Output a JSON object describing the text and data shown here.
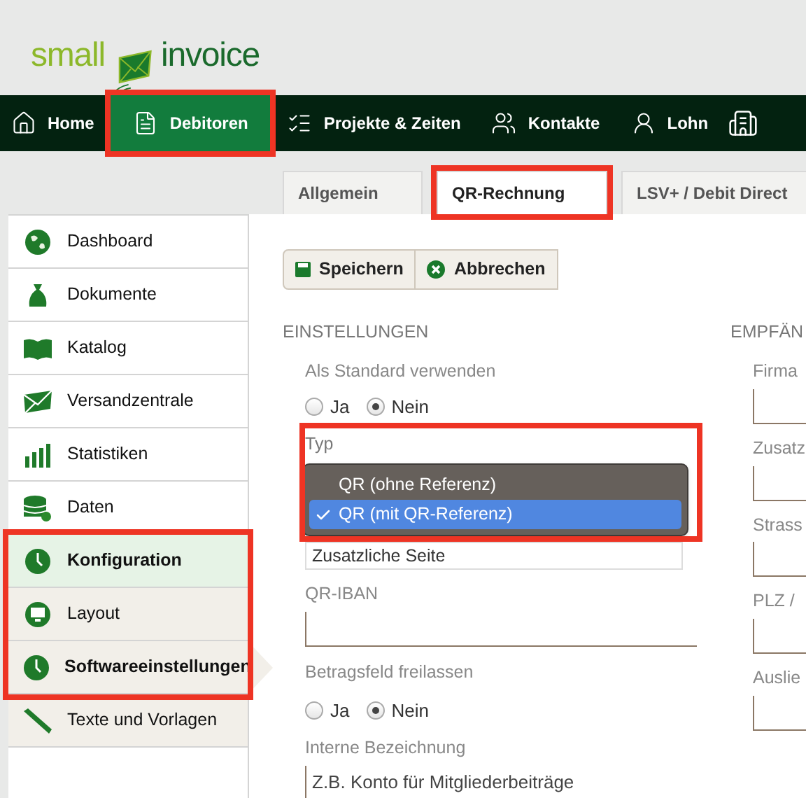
{
  "logo": {
    "text_left": "small",
    "text_right": "invoice"
  },
  "nav": [
    {
      "label": "Home",
      "selected": false,
      "highlighted": false
    },
    {
      "label": "Debitoren",
      "selected": true,
      "highlighted": true
    },
    {
      "label": "Projekte & Zeiten",
      "selected": false,
      "highlighted": false
    },
    {
      "label": "Kontakte",
      "selected": false,
      "highlighted": false
    },
    {
      "label": "Lohn",
      "selected": false,
      "highlighted": false
    }
  ],
  "tabs": [
    {
      "label": "Allgemein",
      "selected": false,
      "highlighted": false
    },
    {
      "label": "QR-Rechnung",
      "selected": true,
      "highlighted": true
    },
    {
      "label": "LSV+ / Debit Direct",
      "selected": false,
      "highlighted": false
    }
  ],
  "sidebar": {
    "items": [
      {
        "label": "Dashboard",
        "kind": "main",
        "selected": false,
        "highlighted": false
      },
      {
        "label": "Dokumente",
        "kind": "main",
        "selected": false,
        "highlighted": false
      },
      {
        "label": "Katalog",
        "kind": "main",
        "selected": false,
        "highlighted": false
      },
      {
        "label": "Versandzentrale",
        "kind": "main",
        "selected": false,
        "highlighted": false
      },
      {
        "label": "Statistiken",
        "kind": "main",
        "selected": false,
        "highlighted": false
      },
      {
        "label": "Daten",
        "kind": "main",
        "selected": false,
        "highlighted": false
      },
      {
        "label": "Konfiguration",
        "kind": "group",
        "selected": false,
        "highlighted": true
      },
      {
        "label": "Layout",
        "kind": "sub",
        "selected": false,
        "highlighted": true
      },
      {
        "label": "Softwareeinstellungen",
        "kind": "sub",
        "selected": true,
        "highlighted": true
      },
      {
        "label": "Texte und Vorlagen",
        "kind": "sub",
        "selected": false,
        "highlighted": false
      }
    ]
  },
  "toolbar": [
    {
      "label": "Speichern",
      "kind": "save"
    },
    {
      "label": "Abbrechen",
      "kind": "cancel"
    }
  ],
  "settings": {
    "heading": "EINSTELLUNGEN",
    "default": {
      "label": "Als Standard verwenden",
      "options": [
        {
          "label": "Ja",
          "selected": false
        },
        {
          "label": "Nein",
          "selected": true
        }
      ]
    },
    "type": {
      "label": "Typ",
      "highlighted": true,
      "options": [
        {
          "label": "QR (ohne Referenz)",
          "selected": false
        },
        {
          "label": "QR (mit QR-Referenz)",
          "selected": true
        }
      ]
    },
    "extra_page": {
      "value": "Zusatzliche Seite"
    },
    "qr_iban": {
      "label": "QR-IBAN"
    },
    "amount_blank": {
      "label": "Betragsfeld freilassen",
      "options": [
        {
          "label": "Ja",
          "selected": false
        },
        {
          "label": "Nein",
          "selected": true
        }
      ]
    },
    "internal": {
      "label": "Interne Bezeichnung",
      "placeholder": "Z.B. Konto für Mitgliederbeiträge"
    }
  },
  "recipient": {
    "heading": "EMPFÄN",
    "fields": [
      {
        "label": "Firma"
      },
      {
        "label": "Zusatz"
      },
      {
        "label": "Strass"
      },
      {
        "label": "PLZ /"
      },
      {
        "label": "Auslie"
      }
    ]
  }
}
